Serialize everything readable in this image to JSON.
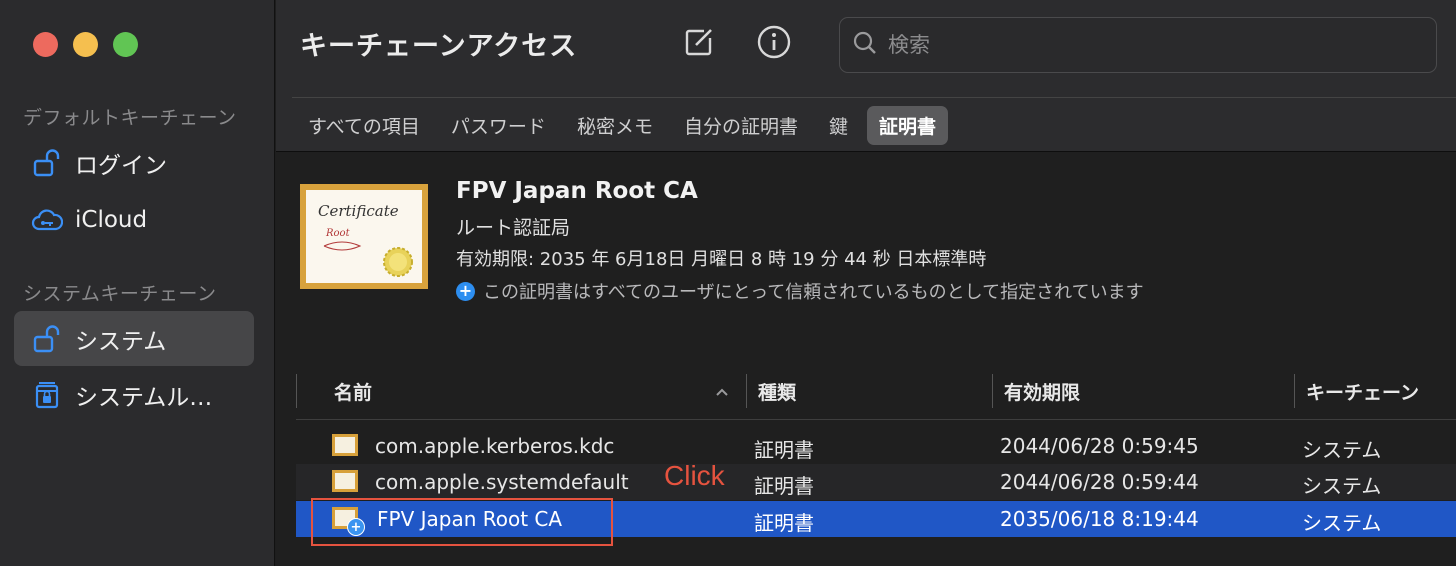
{
  "window": {
    "traffic_lights": [
      "close",
      "minimize",
      "zoom"
    ]
  },
  "sidebar": {
    "section_default": "デフォルトキーチェーン",
    "default_items": [
      {
        "label": "ログイン",
        "icon": "unlock-icon"
      },
      {
        "label": "iCloud",
        "icon": "cloud-lock-icon"
      }
    ],
    "section_system": "システムキーチェーン",
    "system_items": [
      {
        "label": "システム",
        "icon": "unlock-icon",
        "selected": true
      },
      {
        "label": "システムル…",
        "icon": "cabinet-lock-icon"
      }
    ]
  },
  "toolbar": {
    "title": "キーチェーンアクセス",
    "compose_icon": "compose-icon",
    "info_icon": "info-icon",
    "search_placeholder": "検索"
  },
  "tabs": [
    {
      "label": "すべての項目"
    },
    {
      "label": "パスワード"
    },
    {
      "label": "秘密メモ"
    },
    {
      "label": "自分の証明書"
    },
    {
      "label": "鍵"
    },
    {
      "label": "証明書",
      "active": true
    }
  ],
  "detail": {
    "name": "FPV Japan Root CA",
    "type": "ルート認証局",
    "expiry": "有効期限: 2035 年 6月18日 月曜日 8 時 19 分 44 秒 日本標準時",
    "trust": "この証明書はすべてのユーザにとって信頼されているものとして指定されています",
    "image_text_1": "Certificate",
    "image_text_2": "Root"
  },
  "table": {
    "columns": [
      "名前",
      "種類",
      "有効期限",
      "キーチェーン"
    ],
    "rows": [
      {
        "name": "com.apple.kerberos.kdc",
        "kind": "証明書",
        "expires": "2044/06/28 0:59:45",
        "keychain": "システム"
      },
      {
        "name": "com.apple.systemdefault",
        "kind": "証明書",
        "expires": "2044/06/28 0:59:44",
        "keychain": "システム"
      },
      {
        "name": "FPV Japan Root CA",
        "kind": "証明書",
        "expires": "2035/06/18 8:19:44",
        "keychain": "システム",
        "selected": true
      }
    ]
  },
  "annotation": {
    "label": "Click",
    "color": "#e5533f"
  },
  "colors": {
    "selection": "#2057c6",
    "accent": "#2d8ef0",
    "sidebar_bg": "#2b2b2d"
  }
}
